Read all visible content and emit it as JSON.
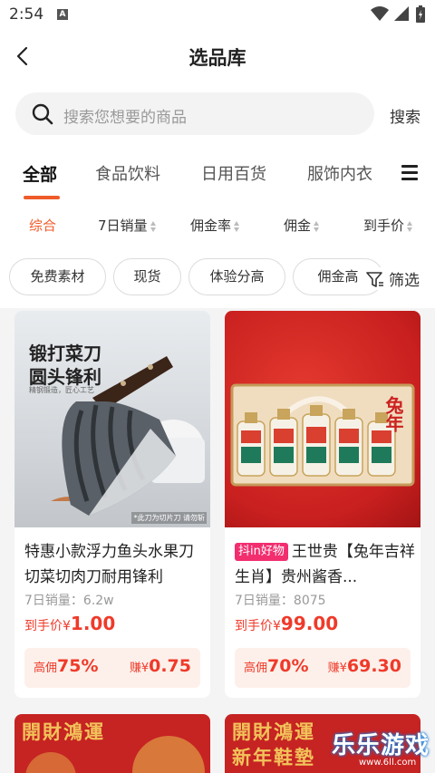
{
  "status_bar": {
    "time": "2:54",
    "badge": "A"
  },
  "header": {
    "title": "选品库"
  },
  "search": {
    "placeholder": "搜索您想要的商品",
    "button": "搜索"
  },
  "tabs": [
    {
      "label": "全部",
      "active": true
    },
    {
      "label": "食品饮料"
    },
    {
      "label": "日用百货"
    },
    {
      "label": "服饰内衣"
    }
  ],
  "sort_options": [
    {
      "label": "综合",
      "active": true
    },
    {
      "label": "7日销量"
    },
    {
      "label": "佣金率"
    },
    {
      "label": "佣金"
    },
    {
      "label": "到手价"
    }
  ],
  "filter_chips": [
    "免费素材",
    "现货",
    "体验分高",
    "佣金高"
  ],
  "filter_label": "筛选",
  "products": [
    {
      "image_title": "锻打菜刀\n圆头锋利",
      "image_sub": "精钢锻造，匠心工艺",
      "image_note": "*此刀为切片刀 请勿斩",
      "badge": "",
      "name": "特惠小款浮力鱼头水果刀切菜切肉刀耐用锋利",
      "sales": "7日销量：6.2w",
      "price_label": "到手价¥",
      "price": "1.00",
      "commission_label": "高佣",
      "commission_rate": "75%",
      "earn_label": "赚¥",
      "earn": "0.75"
    },
    {
      "image_title": "兔年",
      "image_sub": "",
      "image_note": "",
      "badge": "抖in好物",
      "name": "王世贵【兔年吉祥生肖】贵州酱香...",
      "sales": "7日销量：8075",
      "price_label": "到手价¥",
      "price": "99.00",
      "commission_label": "高佣",
      "commission_rate": "70%",
      "earn_label": "赚¥",
      "earn": "69.30"
    }
  ],
  "bottom_cards": [
    {
      "text": "開財鴻運"
    },
    {
      "text": "開財鴻運\n新年鞋墊"
    }
  ],
  "watermark": {
    "title": "乐乐游戏",
    "url": "www.6ll.com"
  },
  "colors": {
    "accent": "#ef5b2a",
    "price": "#ef3a2a",
    "badge": "#f22e6f"
  }
}
